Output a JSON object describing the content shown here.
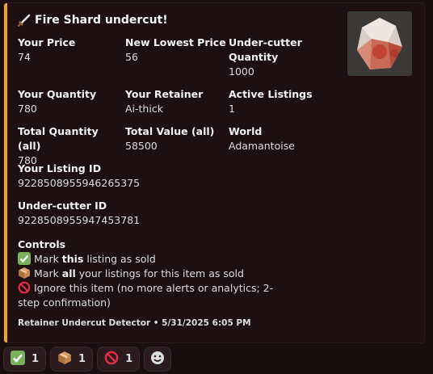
{
  "embed": {
    "accent_color": "#f0a42b",
    "title_icon": "dagger-icon",
    "title": "Fire Shard undercut!",
    "thumbnail": "fire-shard-crystal-icon",
    "fields": [
      {
        "name": "Your Price",
        "value": "74"
      },
      {
        "name": "New Lowest Price",
        "value": "56"
      },
      {
        "name": "Under-cutter Quantity",
        "value": "1000"
      },
      {
        "name": "Your Quantity",
        "value": "780"
      },
      {
        "name": "Your Retainer",
        "value": "Ai-thick"
      },
      {
        "name": "Active Listings",
        "value": "1"
      },
      {
        "name": "Total Quantity (all)",
        "value": "780"
      },
      {
        "name": "Total Value (all)",
        "value": "58500"
      },
      {
        "name": "World",
        "value": "Adamantoise"
      },
      {
        "name": "Your Listing ID",
        "value": "9228508955946265375"
      },
      {
        "name": "Under-cutter ID",
        "value": "9228508955947453781"
      }
    ],
    "controls": {
      "name": "Controls",
      "line1": {
        "icon": "check-mark-icon",
        "pre": "Mark ",
        "bold": "this",
        "post": " listing as sold"
      },
      "line2": {
        "icon": "package-icon",
        "pre": "Mark ",
        "bold": "all",
        "post": " your listings for this item as sold"
      },
      "line3": {
        "icon": "prohibited-icon",
        "text": "Ignore this item (no more alerts or analytics; 2-step confirmation)"
      }
    },
    "footer": "Retainer Undercut Detector • 5/31/2025 6:05 PM"
  },
  "reactions": [
    {
      "icon": "check-mark-icon",
      "count": "1"
    },
    {
      "icon": "package-icon",
      "count": "1"
    },
    {
      "icon": "prohibited-icon",
      "count": "1"
    }
  ],
  "add_reaction_icon": "smiley-add-icon"
}
